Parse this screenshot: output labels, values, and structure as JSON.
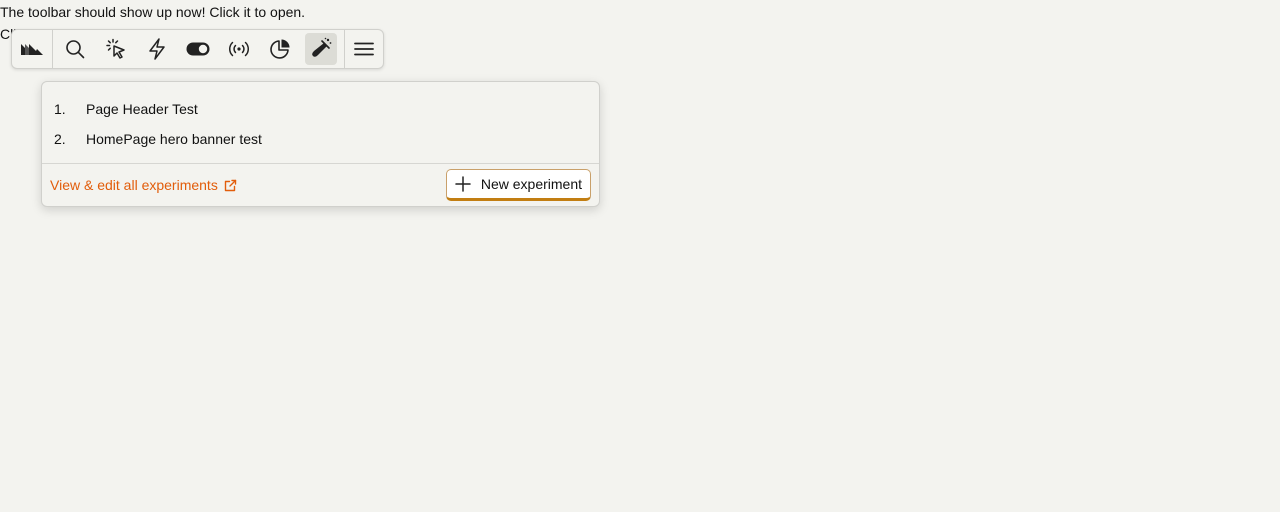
{
  "page": {
    "line1": "The toolbar should show up now! Click it to open.",
    "line2": "Click M"
  },
  "toolbar": {
    "buttons": [
      {
        "name": "logo",
        "icon": "hedgehog-logo-icon"
      },
      {
        "name": "search",
        "icon": "search-icon"
      },
      {
        "name": "inspect",
        "icon": "cursor-click-icon"
      },
      {
        "name": "actions",
        "icon": "lightning-icon"
      },
      {
        "name": "feature-flags",
        "icon": "toggle-icon"
      },
      {
        "name": "events",
        "icon": "broadcast-icon"
      },
      {
        "name": "heatmap",
        "icon": "pie-chart-icon"
      },
      {
        "name": "experiments",
        "icon": "flask-icon",
        "active": true
      },
      {
        "name": "menu",
        "icon": "hamburger-menu-icon"
      }
    ]
  },
  "experiments": {
    "items": [
      {
        "number": "1.",
        "name": "Page Header Test"
      },
      {
        "number": "2.",
        "name": "HomePage hero banner test"
      }
    ],
    "view_all_label": "View & edit all experiments",
    "new_button_label": "New experiment"
  },
  "colors": {
    "accent": "#e25d0b",
    "background": "#f3f3ef"
  }
}
